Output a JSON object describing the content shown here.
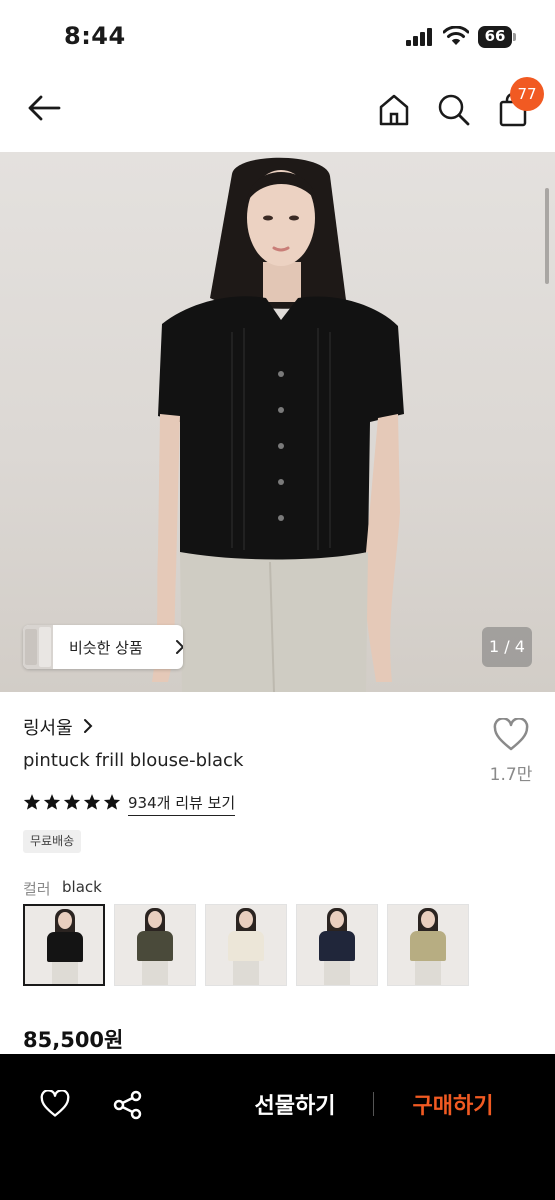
{
  "status_bar": {
    "time": "8:44",
    "battery": "66"
  },
  "nav": {
    "cart_count": "77"
  },
  "gallery": {
    "similar_label": "비슷한 상품",
    "page_indicator": "1 / 4"
  },
  "product": {
    "brand": "링서울",
    "name": "pintuck frill blouse-black",
    "like_count": "1.7만",
    "rating_stars": 5,
    "review_link": "934개 리뷰 보기",
    "shipping_badge": "무료배송",
    "color_label": "컬러",
    "color_value": "black",
    "color_options": [
      {
        "name": "black",
        "hex": "#141414",
        "selected": true
      },
      {
        "name": "khaki",
        "hex": "#4a4a3a",
        "selected": false
      },
      {
        "name": "ivory",
        "hex": "#ece6d8",
        "selected": false
      },
      {
        "name": "navy",
        "hex": "#20263a",
        "selected": false
      },
      {
        "name": "beige",
        "hex": "#b7ad82",
        "selected": false
      }
    ],
    "price": "85,500원"
  },
  "bottom_bar": {
    "gift_label": "선물하기",
    "buy_label": "구매하기"
  },
  "colors": {
    "accent": "#f15a22",
    "bottom_bar_bg": "#000000"
  }
}
